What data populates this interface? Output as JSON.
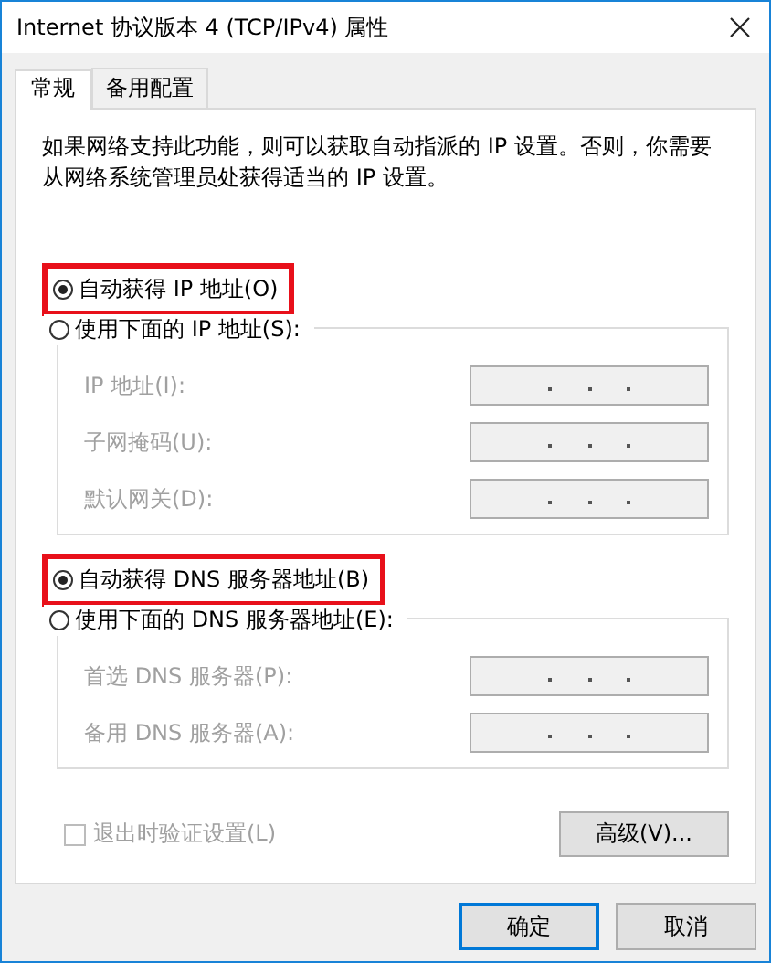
{
  "window": {
    "title": "Internet 协议版本 4 (TCP/IPv4) 属性"
  },
  "tabs": [
    {
      "label": "常规",
      "selected": true
    },
    {
      "label": "备用配置",
      "selected": false
    }
  ],
  "description": "如果网络支持此功能，则可以获取自动指派的 IP 设置。否则，你需要从网络系统管理员处获得适当的 IP 设置。",
  "ip_section": {
    "auto_option": {
      "label": "自动获得 IP 地址(O)",
      "selected": true,
      "highlighted": true
    },
    "manual_option": {
      "label": "使用下面的 IP 地址(S):",
      "selected": false
    },
    "fields": [
      {
        "label": "IP 地址(I):",
        "disabled": true
      },
      {
        "label": "子网掩码(U):",
        "disabled": true
      },
      {
        "label": "默认网关(D):",
        "disabled": true
      }
    ]
  },
  "dns_section": {
    "auto_option": {
      "label": "自动获得 DNS 服务器地址(B)",
      "selected": true,
      "highlighted": true
    },
    "manual_option": {
      "label": "使用下面的 DNS 服务器地址(E):",
      "selected": false
    },
    "fields": [
      {
        "label": "首选 DNS 服务器(P):",
        "disabled": true
      },
      {
        "label": "备用 DNS 服务器(A):",
        "disabled": true
      }
    ]
  },
  "validate_checkbox": {
    "label": "退出时验证设置(L)",
    "checked": false,
    "disabled": true
  },
  "advanced_button": {
    "label": "高级(V)..."
  },
  "buttons": [
    {
      "label": "确定",
      "default": true
    },
    {
      "label": "取消",
      "default": false
    }
  ]
}
